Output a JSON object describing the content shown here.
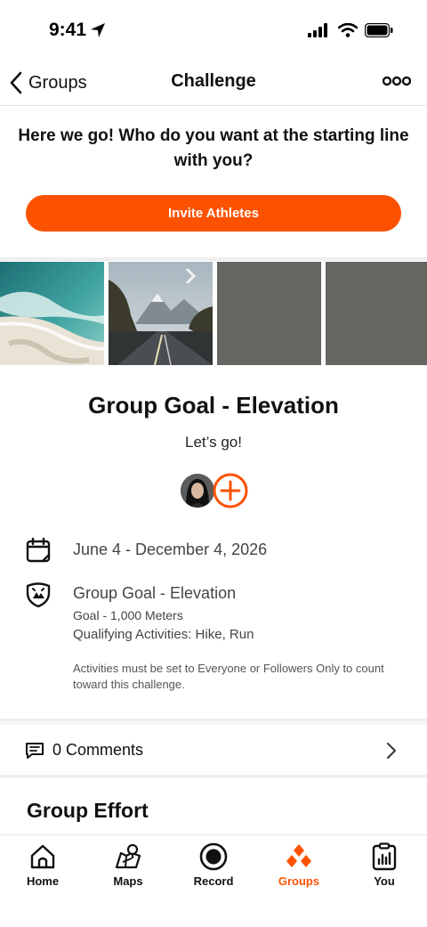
{
  "status_bar": {
    "time": "9:41"
  },
  "nav": {
    "back_label": "Groups",
    "title": "Challenge"
  },
  "invite": {
    "heading": "Here we go! Who do you want at the starting line with you?",
    "button_label": "Invite Athletes"
  },
  "goal": {
    "title": "Group Goal - Elevation",
    "subtitle": "Let’s go!",
    "date_range": "June 4 - December 4, 2026",
    "type": "Group Goal - Elevation",
    "target": "Goal - 1,000 Meters",
    "qualifying": "Qualifying Activities: Hike, Run",
    "note": "Activities must be set to Everyone or Followers Only to count toward this challenge."
  },
  "comments": {
    "label": "0 Comments"
  },
  "group_effort": {
    "heading": "Group Effort"
  },
  "tabs": [
    {
      "label": "Home",
      "icon": "home-icon"
    },
    {
      "label": "Maps",
      "icon": "map-icon"
    },
    {
      "label": "Record",
      "icon": "record-icon"
    },
    {
      "label": "Groups",
      "icon": "groups-icon",
      "active": true
    },
    {
      "label": "You",
      "icon": "you-icon"
    }
  ],
  "colors": {
    "accent": "#fc5200",
    "tile_gray": "#656562"
  }
}
